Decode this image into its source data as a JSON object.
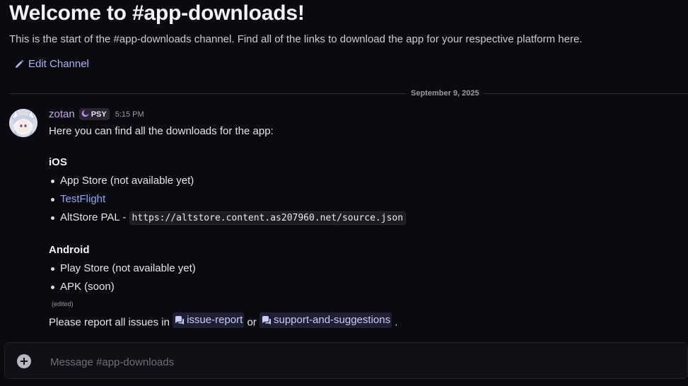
{
  "channel": {
    "welcome_title": "Welcome to #app-downloads!",
    "welcome_description": "This is the start of the #app-downloads channel. Find all of the links to download the app for your respective platform here.",
    "edit_label": "Edit Channel"
  },
  "divider": {
    "date": "September 9, 2025"
  },
  "message": {
    "author": "zotan",
    "tag": "PSY",
    "time": "5:15 PM",
    "intro": "Here you can find all the downloads for the app:",
    "ios_heading": "iOS",
    "ios_items": {
      "app_store": "App Store (not available yet)",
      "testflight": "TestFlight",
      "altstore_prefix": "AltStore PAL - ",
      "altstore_url": "https://altstore.content.as207960.net/source.json"
    },
    "android_heading": "Android",
    "android_items": {
      "play_store": "Play Store (not available yet)",
      "apk": "APK (soon)"
    },
    "edited": "(edited)",
    "report_prefix": "Please report all issues in",
    "report_or": "or",
    "report_suffix": ".",
    "channel_issue": "issue-report",
    "channel_support": "support-and-suggestions"
  },
  "composer": {
    "placeholder": "Message #app-downloads"
  },
  "colors": {
    "background": "#0b0a10",
    "link": "#8fa6f5",
    "username": "#c5a6e8",
    "mention_bg": "#1f1f33"
  },
  "icons": {
    "edit": "pencil-icon",
    "tag": "crescent-icon",
    "channel": "forum-channel-icon",
    "add": "plus-circle-icon"
  }
}
